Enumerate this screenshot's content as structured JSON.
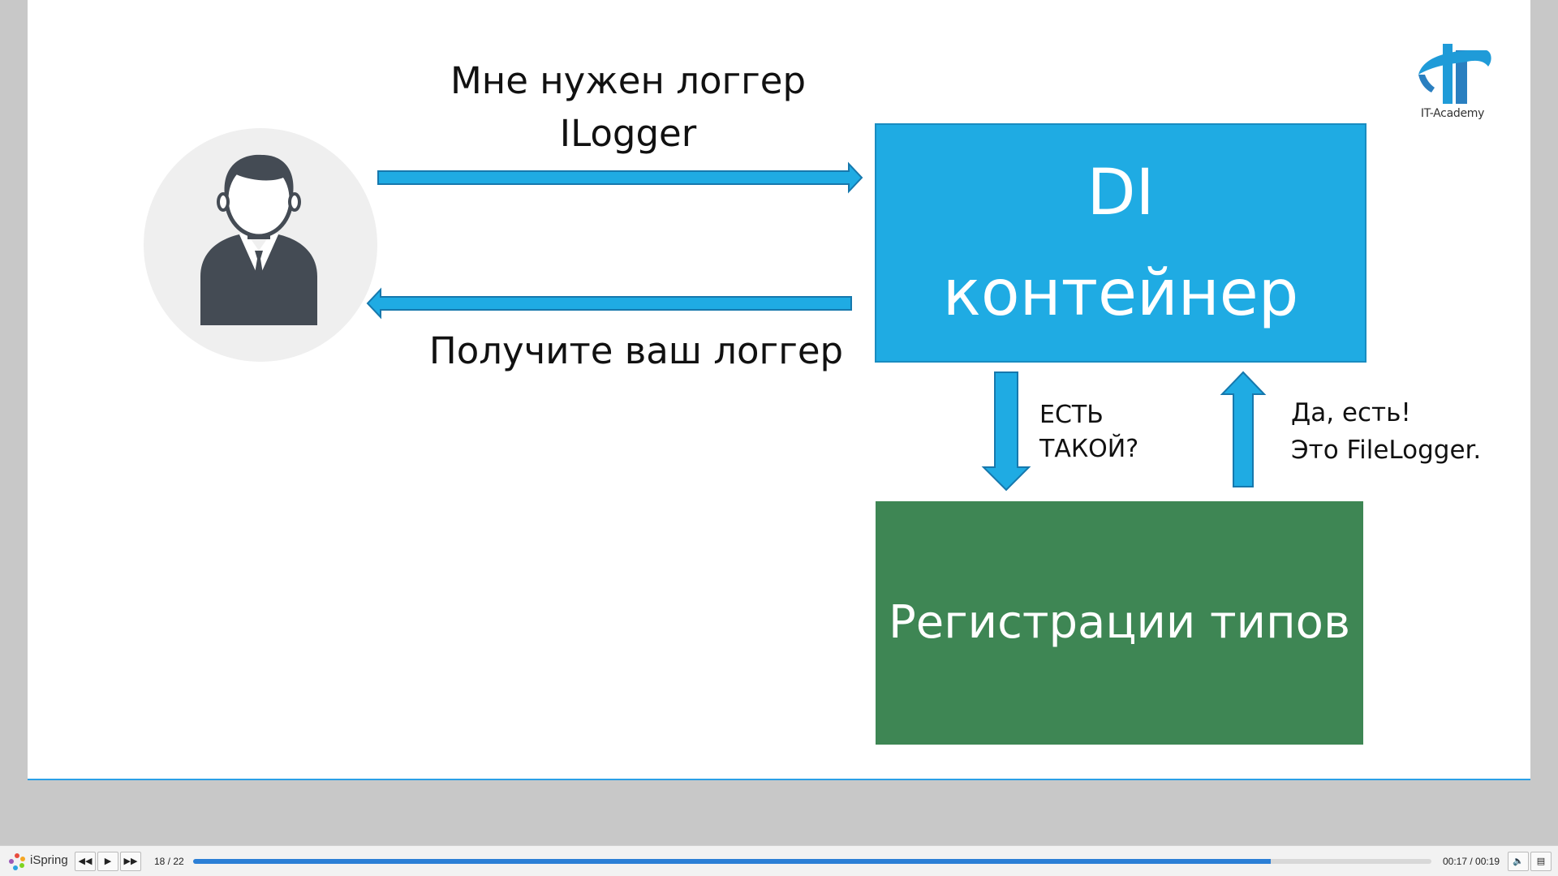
{
  "slide": {
    "request_line1": "Мне нужен логгер",
    "request_line2": "ILogger",
    "response_text": "Получите ваш логгер",
    "di_box": {
      "line1": "DI",
      "line2": "контейнер"
    },
    "registry_box": {
      "text": "Регистрации типов"
    },
    "ask_line1": "ЕСТЬ",
    "ask_line2": "ТАКОЙ?",
    "answer_line1": "Да, есть!",
    "answer_line2": "Это FileLogger.",
    "logo_text": "IT-Academy"
  },
  "colors": {
    "arrow_fill": "#1fabe3",
    "arrow_stroke": "#1678ad",
    "di_box": "#1fabe3",
    "registry_box": "#3e8654",
    "footer_band": "#2583c8",
    "avatar_figure": "#444b54"
  },
  "player": {
    "brand": "iSpring",
    "slide_counter": "18 / 22",
    "time": "00:17 / 00:19",
    "progress": 0.87
  }
}
